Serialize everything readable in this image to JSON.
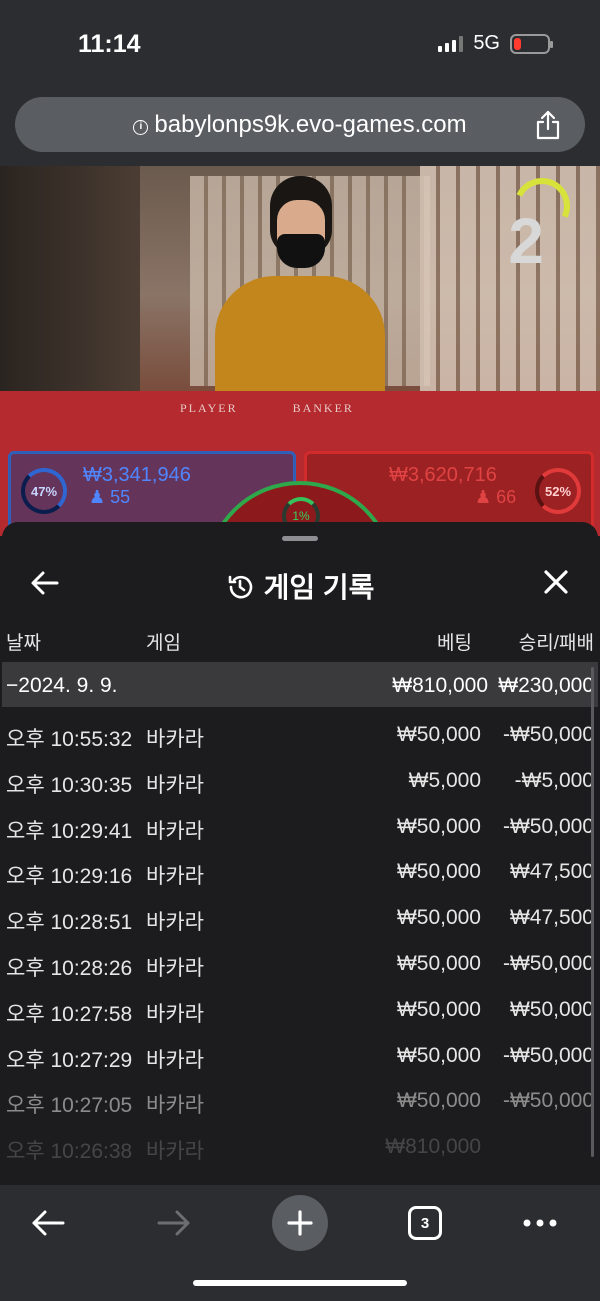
{
  "status": {
    "time": "11:14",
    "network": "5G"
  },
  "browser": {
    "url": "babylonps9k.evo-games.com",
    "tab_count": "3"
  },
  "stream": {
    "countdown": "2",
    "table_labels": {
      "player": "PLAYER",
      "banker": "BANKER"
    },
    "player": {
      "percent": "47%",
      "amount": "₩3,341,946",
      "count": "55"
    },
    "banker": {
      "percent": "52%",
      "amount": "₩3,620,716",
      "count": "66"
    },
    "tie": {
      "percent": "1%"
    }
  },
  "history": {
    "title": "게임 기록",
    "columns": {
      "date": "날짜",
      "game": "게임",
      "bet": "베팅",
      "result": "승리/패배"
    },
    "summary": {
      "date": "−2024. 9. 9.",
      "bet": "₩810,000",
      "result": "₩230,000"
    },
    "rows": [
      {
        "time": "오후 10:55:32",
        "game": "바카라",
        "bet": "₩50,000",
        "result": "-₩50,000"
      },
      {
        "time": "오후 10:30:35",
        "game": "바카라",
        "bet": "₩5,000",
        "result": "-₩5,000"
      },
      {
        "time": "오후 10:29:41",
        "game": "바카라",
        "bet": "₩50,000",
        "result": "-₩50,000"
      },
      {
        "time": "오후 10:29:16",
        "game": "바카라",
        "bet": "₩50,000",
        "result": "₩47,500"
      },
      {
        "time": "오후 10:28:51",
        "game": "바카라",
        "bet": "₩50,000",
        "result": "₩47,500"
      },
      {
        "time": "오후 10:28:26",
        "game": "바카라",
        "bet": "₩50,000",
        "result": "-₩50,000"
      },
      {
        "time": "오후 10:27:58",
        "game": "바카라",
        "bet": "₩50,000",
        "result": "₩50,000"
      },
      {
        "time": "오후 10:27:29",
        "game": "바카라",
        "bet": "₩50,000",
        "result": "-₩50,000"
      },
      {
        "time": "오후 10:27:05",
        "game": "바카라",
        "bet": "₩50,000",
        "result": "-₩50,000"
      },
      {
        "time": "오후 10:26:38",
        "game": "바카라",
        "bet": "₩810,000",
        "result": ""
      }
    ]
  },
  "colors": {
    "player": "#2f66d1",
    "banker": "#e13a3a",
    "tie": "#2ea84a",
    "accent": "#d7e23a"
  }
}
